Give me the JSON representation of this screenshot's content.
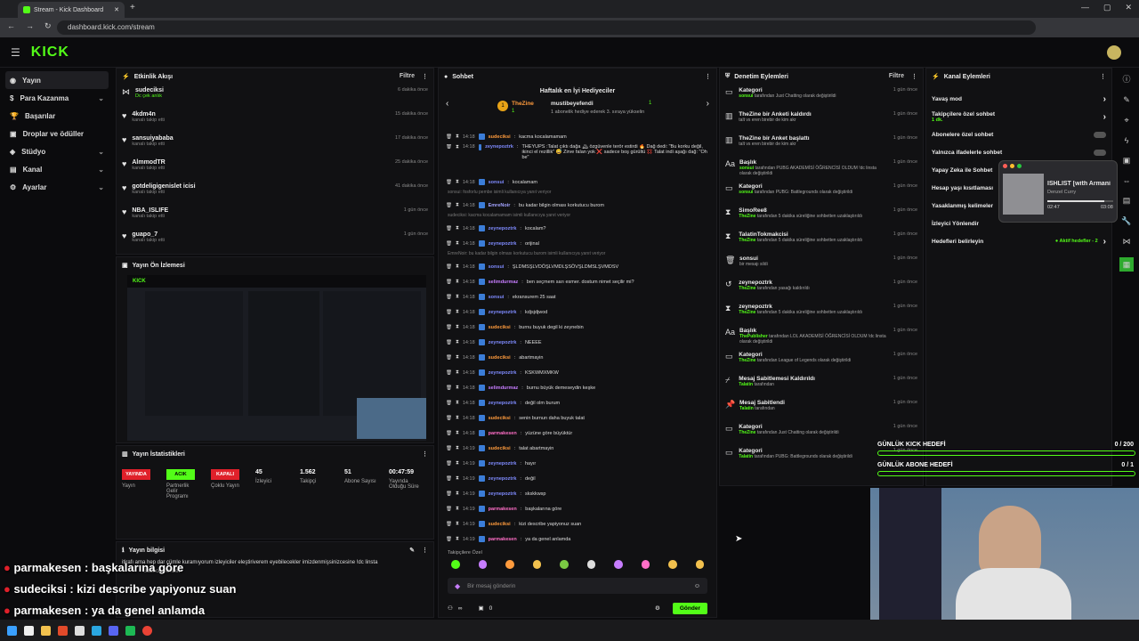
{
  "browser": {
    "tab_title": "Stream - Kick Dashboard",
    "url": "dashboard.kick.com/stream"
  },
  "app": {
    "logo": "KICK"
  },
  "sidebar": {
    "items": [
      {
        "label": "Yayın",
        "active": true
      },
      {
        "label": "Para Kazanma",
        "chevron": true
      },
      {
        "label": "Başarılar"
      },
      {
        "label": "Droplar ve ödüller"
      },
      {
        "label": "Stüdyo",
        "chevron": true
      },
      {
        "label": "Kanal",
        "chevron": true
      },
      {
        "label": "Ayarlar",
        "chevron": true
      }
    ]
  },
  "activity": {
    "title": "Etkinlik Akışı",
    "filter": "Filtre",
    "items": [
      {
        "name": "sudeciksi",
        "sub": "Dc çek anlık",
        "ago": "6 dakika önce"
      },
      {
        "name": "4kdm4n",
        "sub": "kanalı takip etti",
        "ago": "15 dakika önce"
      },
      {
        "name": "sansuiyababa",
        "sub": "kanalı takip etti",
        "ago": "17 dakika önce"
      },
      {
        "name": "AlmmodTR",
        "sub": "kanalı takip etti",
        "ago": "25 dakika önce"
      },
      {
        "name": "gotdeligigenislet icisi",
        "sub": "kanalı takip etti",
        "ago": "41 dakika önce"
      },
      {
        "name": "NBA_ISLIFE",
        "sub": "kanalı takip etti",
        "ago": "1 gün önce"
      },
      {
        "name": "guapo_7",
        "sub": "kanalı takip etti",
        "ago": "1 gün önce"
      }
    ]
  },
  "preview": {
    "title": "Yayın Ön İzlemesi"
  },
  "stats": {
    "title": "Yayın İstatistikleri",
    "items": [
      {
        "badge": "YAYINDA",
        "label": "Yayın",
        "color": "#e0202a"
      },
      {
        "badge": "ACIK",
        "label": "Partnerlik Gelir Programı",
        "color": "#53fc18"
      },
      {
        "badge": "KAPALI",
        "label": "Çoklu Yayın",
        "color": "#e0202a"
      },
      {
        "value": "45",
        "label": "İzleyici"
      },
      {
        "value": "1.562",
        "label": "Takipçi"
      },
      {
        "value": "51",
        "label": "Abone Sayısı"
      },
      {
        "value": "00:47:59",
        "label": "Yayında Olduğu Süre"
      }
    ]
  },
  "info": {
    "title": "Yayın bilgisi",
    "line": "itirafı ama hep dar cümle kuramıyorum izleyiciler eleştiriverem eyebilecekler imizdenmişsinizcesine !dc linsta",
    "sub": "Sadece Sohbet"
  },
  "chat": {
    "title": "Sohbet",
    "top_title": "Haftalık en İyi Hediyeciler",
    "top_name": "TheZine",
    "top_count": "1",
    "top_rank": "1",
    "top2_name": "mustibeyefendi",
    "top2_count": "1",
    "top_note": "1 abonelik hediye ederek 3. sıraya yükselin",
    "lines": [
      {
        "type": "msg",
        "time": "14:18",
        "user": "sudeciksi",
        "color": "#ff9b3d",
        "text": "kacma kocalamamam"
      },
      {
        "type": "msg",
        "time": "14:18",
        "user": "zeynepoztrk",
        "color": "#7f8bff",
        "text": "THEYUPS :Talat çıktı dağa 🏔 özgüvenle terör estirdi 🔥 Dağ dedi: \"Bu korku değil, ikinci el rezillik\" 😅 Zirve falan yok ❌ sadece boş gürültü 💢 Talat indi aşağı dağ: \"Oh be\""
      },
      {
        "type": "msg",
        "time": "14:18",
        "user": "sonsui",
        "color": "#7f8bff",
        "text": "kocalamam"
      },
      {
        "type": "reply",
        "text": "sonsui: fosforlu pembe isimli kullanıcıya yanıt veriyor"
      },
      {
        "type": "msg",
        "time": "14:18",
        "user": "EmreNoir",
        "color": "#a3a3ff",
        "text": "bu kadar bilgin olması korkutucu burom"
      },
      {
        "type": "reply",
        "text": "sudeciksi: kacma kocalamamam isimli kullanıcıya yanıt veriyor"
      },
      {
        "type": "msg",
        "time": "14:18",
        "user": "zeynepoztrk",
        "color": "#7f8bff",
        "text": "kocalam?"
      },
      {
        "type": "msg",
        "time": "14:18",
        "user": "zeynepoztrk",
        "color": "#7f8bff",
        "text": "orijinal"
      },
      {
        "type": "reply",
        "text": "EmreNoir: bu kadar bilgin olması korkutucu burom isimli kullanıcıya yanıt veriyor"
      },
      {
        "type": "msg",
        "time": "14:18",
        "user": "sonsui",
        "color": "#7f8bff",
        "text": "ŞLDMSŞLVDÖŞLVMDLŞSÖVŞLDMSLŞVMDSV"
      },
      {
        "type": "msg",
        "time": "14:18",
        "user": "selimdurmaz",
        "color": "#c77dff",
        "text": "ben seçmem sarı esmer. dostum nimet seçilir mi?"
      },
      {
        "type": "msg",
        "time": "14:18",
        "user": "sonsui",
        "color": "#7f8bff",
        "text": "ekransurem 25 saat"
      },
      {
        "type": "msg",
        "time": "14:18",
        "user": "zeynepoztrk",
        "color": "#7f8bff",
        "text": "kdjsjdjwod"
      },
      {
        "type": "msg",
        "time": "14:18",
        "user": "sudeciksi",
        "color": "#ff9b3d",
        "text": "burnu buyuk degil ki zeynebin"
      },
      {
        "type": "msg",
        "time": "14:18",
        "user": "zeynepoztrk",
        "color": "#7f8bff",
        "text": "NEEEE"
      },
      {
        "type": "msg",
        "time": "14:18",
        "user": "sudeciksi",
        "color": "#ff9b3d",
        "text": "abartmayin"
      },
      {
        "type": "msg",
        "time": "14:18",
        "user": "zeynepoztrk",
        "color": "#7f8bff",
        "text": "KSKWMXMKW"
      },
      {
        "type": "msg",
        "time": "14:18",
        "user": "selimdurmaz",
        "color": "#c77dff",
        "text": "burnu büyük demeseydin keşke"
      },
      {
        "type": "msg",
        "time": "14:18",
        "user": "zeynepoztrk",
        "color": "#7f8bff",
        "text": "değil olm burum"
      },
      {
        "type": "msg",
        "time": "14:18",
        "user": "sudeciksi",
        "color": "#ff9b3d",
        "text": "senin burnun daha buyuk talat"
      },
      {
        "type": "msg",
        "time": "14:18",
        "user": "parmakesen",
        "color": "#ff6ec7",
        "text": "yüzüne göre büyüktür"
      },
      {
        "type": "msg",
        "time": "14:19",
        "user": "sudeciksi",
        "color": "#ff9b3d",
        "text": "talat abartmayin"
      },
      {
        "type": "msg",
        "time": "14:19",
        "user": "zeynepoztrk",
        "color": "#7f8bff",
        "text": "hayır"
      },
      {
        "type": "msg",
        "time": "14:19",
        "user": "zeynepoztrk",
        "color": "#7f8bff",
        "text": "değil"
      },
      {
        "type": "msg",
        "time": "14:19",
        "user": "zeynepoztrk",
        "color": "#7f8bff",
        "text": "skskkwsp"
      },
      {
        "type": "msg",
        "time": "14:19",
        "user": "parmakesen",
        "color": "#ff6ec7",
        "text": "başkalarına göre"
      },
      {
        "type": "msg",
        "time": "14:19",
        "user": "sudeciksi",
        "color": "#ff9b3d",
        "text": "kizi describe yapiyonuz suan"
      },
      {
        "type": "msg",
        "time": "14:19",
        "user": "parmakesen",
        "color": "#ff6ec7",
        "text": "ya da genel anlamda"
      }
    ],
    "emote_label": "Takipçilere Özel",
    "placeholder": "Bir mesaj gönderin",
    "send": "Gönder",
    "viewers": "∞",
    "count": "0"
  },
  "mod": {
    "title": "Denetim Eylemleri",
    "filter": "Filtre",
    "items": [
      {
        "icon": "tv",
        "title": "Kategori",
        "desc_user": "sonsui",
        "desc": "tarafından Just Chatting olarak değiştirildi",
        "ago": "1 gün önce"
      },
      {
        "icon": "chart",
        "title": "TheZine bir Anketi kaldırdı",
        "desc_user": "",
        "desc": "talt vs eren birebir de kim akr",
        "ago": "1 gün önce"
      },
      {
        "icon": "chart",
        "title": "TheZine bir Anket başlattı",
        "desc_user": "",
        "desc": "talt vs eren birebir de kim akr",
        "ago": "1 gün önce"
      },
      {
        "icon": "title",
        "title": "Başlık",
        "desc_user": "sonsui",
        "desc": "tarafından PUBG AKADEMİSİ ÖĞRENCİSİ OLDUM !dc linsta olarak değiştirildi",
        "ago": "1 gün önce"
      },
      {
        "icon": "tv",
        "title": "Kategori",
        "desc_user": "sonsui",
        "desc": "tarafından PUBG: Battlegrounds olarak değiştirildi",
        "ago": "1 gün önce"
      },
      {
        "icon": "hourglass",
        "title": "SimoRee8",
        "desc_user": "TheZine",
        "desc": "tarafından 5 dakika süreliğine sohbetten uzaklaştırıldı",
        "ago": "1 gün önce"
      },
      {
        "icon": "hourglass",
        "title": "TalatinTokmakcisi",
        "desc_user": "TheZine",
        "desc": "tarafından 5 dakika süreliğine sohbetten uzaklaştırıldı",
        "ago": "1 gün önce"
      },
      {
        "icon": "trash",
        "title": "sonsui",
        "desc_user": "",
        "desc": "bir mesajı sildi",
        "ago": "1 gün önce"
      },
      {
        "icon": "undo",
        "title": "zeynepoztrk",
        "desc_user": "TheZine",
        "desc": "tarafından yasağı kaldırıldı",
        "ago": "1 gün önce"
      },
      {
        "icon": "hourglass",
        "title": "zeynepoztrk",
        "desc_user": "TheZine",
        "desc": "tarafından 5 dakika süreliğine sohbetten uzaklaştırıldı",
        "ago": "1 gün önce"
      },
      {
        "icon": "title",
        "title": "Başlık",
        "desc_user": "ThePublisher",
        "desc": "tarafından LOL AKADEMİSİ ÖĞRENCİSİ OLDUM !dc linsta olarak değiştirildi",
        "ago": "1 gün önce"
      },
      {
        "icon": "tv",
        "title": "Kategori",
        "desc_user": "TheZine",
        "desc": "tarafından League of Legends olarak değiştirildi",
        "ago": "1 gün önce"
      },
      {
        "icon": "unpin",
        "title": "Mesaj Sabitlemesi Kaldırıldı",
        "desc_user": "Talatin",
        "desc": "tarafından",
        "ago": "1 gün önce"
      },
      {
        "icon": "pin",
        "title": "Mesaj Sabitlendi",
        "desc_user": "Talatin",
        "desc": "tarafından",
        "ago": "1 gün önce"
      },
      {
        "icon": "tv",
        "title": "Kategori",
        "desc_user": "TheZine",
        "desc": "tarafından Just Chatting olarak değiştirildi",
        "ago": "1 gün önce"
      },
      {
        "icon": "tv",
        "title": "Kategori",
        "desc_user": "Talatin",
        "desc": "tarafından PUBG: Battlegrounds olarak değiştirildi",
        "ago": "1 gün önce"
      }
    ]
  },
  "channel": {
    "title": "Kanal Eylemleri",
    "items": [
      {
        "label": "Yavaş mod",
        "kind": "chev"
      },
      {
        "label": "Takipçilere özel sohbet",
        "sub": "1 dk.",
        "kind": "chev"
      },
      {
        "label": "Abonelere özel sohbet",
        "kind": "toggle"
      },
      {
        "label": "Yalnızca ifadelerle sohbet",
        "kind": "toggle"
      },
      {
        "label": "Yapay Zeka ile Sohbet",
        "kind": "none"
      },
      {
        "label": "Hesap yaşı kısıtlaması",
        "kind": "none"
      },
      {
        "label": "Yasaklanmış kelimeler",
        "kind": "none"
      },
      {
        "label": "İzleyici Yönlendir",
        "kind": "none"
      },
      {
        "label": "Hedefleri belirleyin",
        "extra": "● Aktif hedefler - 2",
        "kind": "chev"
      }
    ]
  },
  "music": {
    "title": "ISHLIST [with Armani",
    "artist": "Denzel Curry",
    "elapsed": "02:47",
    "total": "03:08",
    "progress": 0.86
  },
  "goals": [
    {
      "label": "GÜNLÜK KICK HEDEFİ",
      "value": "0 / 200",
      "progress": 0
    },
    {
      "label": "GÜNLÜK ABONE HEDEFİ",
      "value": "0 / 1",
      "progress": 0
    }
  ],
  "overlay_chat": [
    {
      "user": "parmakesen",
      "text": " : başkalarına göre"
    },
    {
      "user": "sudeciksi",
      "text": " : kizi describe yapiyonuz suan"
    },
    {
      "user": "parmakesen",
      "text": " : ya da genel anlamda"
    }
  ]
}
